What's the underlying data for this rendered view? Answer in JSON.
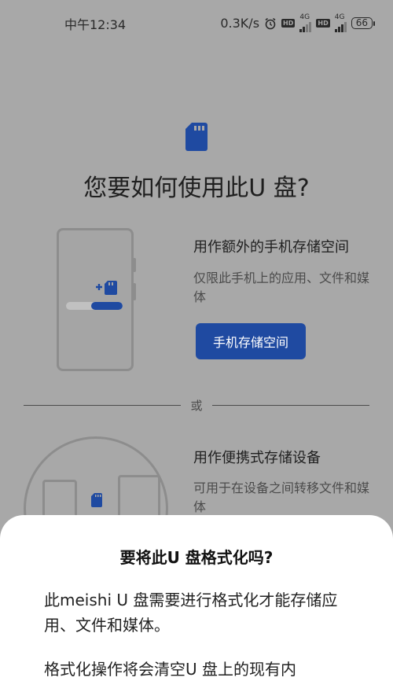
{
  "status_bar": {
    "time": "中午12:34",
    "net_speed": "0.3K/s",
    "hd_badge": "HD",
    "net_type": "4G",
    "battery": "66"
  },
  "page": {
    "title": "您要如何使用此U 盘?"
  },
  "option_internal": {
    "title": "用作额外的手机存储空间",
    "description": "仅限此手机上的应用、文件和媒体",
    "button_label": "手机存储空间",
    "illustration_fill_fraction": 0.55
  },
  "divider": {
    "label": "或"
  },
  "option_portable": {
    "title": "用作便携式存储设备",
    "description": "可用于在设备之间转移文件和媒体"
  },
  "dialog": {
    "title": "要将此U 盘格式化吗?",
    "paragraph1": "此meishi U 盘需要进行格式化才能存储应用、文件和媒体。",
    "paragraph2": "格式化操作将会清空U 盘上的现有内"
  },
  "colors": {
    "accent": "#1f4aa1",
    "overlay_bg": "#a8a8a8",
    "sheet_bg": "#ffffff"
  },
  "icons": {
    "alarm": "alarm-clock-icon",
    "sd_card": "sd-card-icon",
    "signal": "signal-icon",
    "battery": "battery-icon"
  }
}
